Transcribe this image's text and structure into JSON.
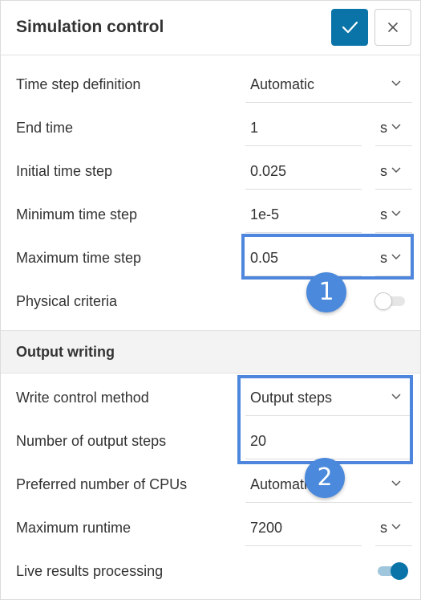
{
  "header": {
    "title": "Simulation control"
  },
  "simulation": {
    "time_step_definition": {
      "label": "Time step definition",
      "value": "Automatic"
    },
    "end_time": {
      "label": "End time",
      "value": "1",
      "unit": "s"
    },
    "initial_time_step": {
      "label": "Initial time step",
      "value": "0.025",
      "unit": "s"
    },
    "minimum_time_step": {
      "label": "Minimum time step",
      "value": "1e-5",
      "unit": "s"
    },
    "maximum_time_step": {
      "label": "Maximum time step",
      "value": "0.05",
      "unit": "s"
    },
    "physical_criteria": {
      "label": "Physical criteria",
      "enabled": false
    }
  },
  "output_writing": {
    "title": "Output writing",
    "write_control_method": {
      "label": "Write control method",
      "value": "Output steps"
    },
    "number_of_output_steps": {
      "label": "Number of output steps",
      "value": "20"
    },
    "preferred_cpus": {
      "label": "Preferred number of CPUs",
      "value": "Automatic"
    },
    "maximum_runtime": {
      "label": "Maximum runtime",
      "value": "7200",
      "unit": "s"
    },
    "live_results_processing": {
      "label": "Live results processing",
      "enabled": true
    }
  },
  "annotations": {
    "badge_1": "1",
    "badge_2": "2"
  },
  "colors": {
    "primary": "#0a74a9",
    "annotation": "#4a89dc"
  }
}
